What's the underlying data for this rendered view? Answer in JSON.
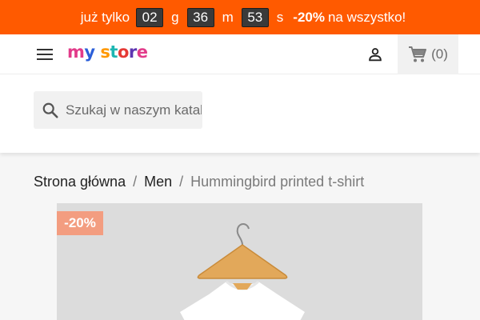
{
  "promo": {
    "prefix": "już tylko",
    "days": "02",
    "days_unit": "g",
    "minutes": "36",
    "minutes_unit": "m",
    "seconds": "53",
    "seconds_unit": "s",
    "discount": "-20%",
    "suffix": "na wszystko!",
    "bg_color": "#ff5a00"
  },
  "header": {
    "menu_icon": "hamburger-menu-icon",
    "logo_text": "my store",
    "user_icon": "user-icon",
    "cart_icon": "cart-icon",
    "cart_count": "(0)"
  },
  "search": {
    "placeholder": "Szukaj w naszym katalogu",
    "icon": "search-icon"
  },
  "breadcrumb": {
    "items": [
      "Strona główna",
      "Men",
      "Hummingbird printed t-shirt"
    ],
    "separator": "/"
  },
  "product": {
    "discount_badge": "-20%",
    "badge_color": "#f39d80"
  }
}
